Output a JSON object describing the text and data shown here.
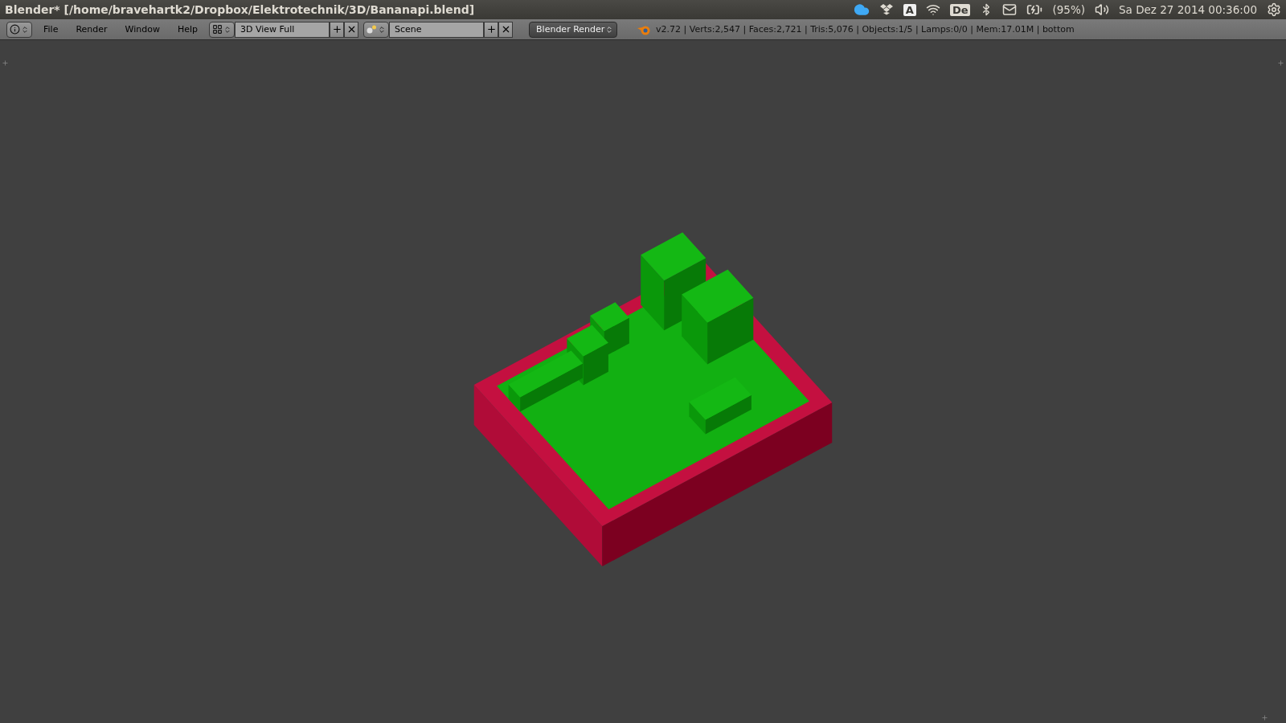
{
  "window": {
    "title": "Blender* [/home/bravehartk2/Dropbox/Elektrotechnik/3D/Bananapi.blend]"
  },
  "tray": {
    "input_indicator": "A",
    "keyboard_layout": "De",
    "battery": "(95%)",
    "clock": "Sa Dez 27 2014 00:36:00"
  },
  "menu": [
    "File",
    "Render",
    "Window",
    "Help"
  ],
  "screen_layout": {
    "value": "3D View Full"
  },
  "scene": {
    "value": "Scene"
  },
  "render_engine": "Blender Render",
  "stats": "v2.72 | Verts:2,547 | Faces:2,721 | Tris:5,076 | Objects:1/5 | Lamps:0/0 | Mem:17.01M | bottom"
}
